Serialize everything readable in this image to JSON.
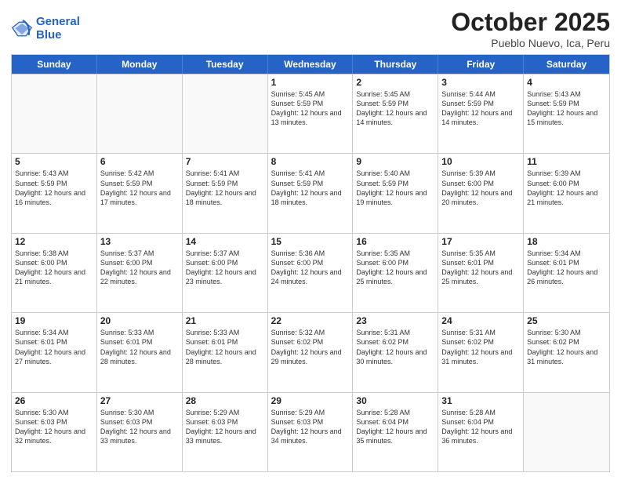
{
  "logo": {
    "line1": "General",
    "line2": "Blue"
  },
  "header": {
    "title": "October 2025",
    "location": "Pueblo Nuevo, Ica, Peru"
  },
  "days_of_week": [
    "Sunday",
    "Monday",
    "Tuesday",
    "Wednesday",
    "Thursday",
    "Friday",
    "Saturday"
  ],
  "weeks": [
    [
      {
        "day": "",
        "empty": true
      },
      {
        "day": "",
        "empty": true
      },
      {
        "day": "",
        "empty": true
      },
      {
        "day": "1",
        "sunrise": "5:45 AM",
        "sunset": "5:59 PM",
        "daylight": "12 hours and 13 minutes."
      },
      {
        "day": "2",
        "sunrise": "5:45 AM",
        "sunset": "5:59 PM",
        "daylight": "12 hours and 14 minutes."
      },
      {
        "day": "3",
        "sunrise": "5:44 AM",
        "sunset": "5:59 PM",
        "daylight": "12 hours and 14 minutes."
      },
      {
        "day": "4",
        "sunrise": "5:43 AM",
        "sunset": "5:59 PM",
        "daylight": "12 hours and 15 minutes."
      }
    ],
    [
      {
        "day": "5",
        "sunrise": "5:43 AM",
        "sunset": "5:59 PM",
        "daylight": "12 hours and 16 minutes."
      },
      {
        "day": "6",
        "sunrise": "5:42 AM",
        "sunset": "5:59 PM",
        "daylight": "12 hours and 17 minutes."
      },
      {
        "day": "7",
        "sunrise": "5:41 AM",
        "sunset": "5:59 PM",
        "daylight": "12 hours and 18 minutes."
      },
      {
        "day": "8",
        "sunrise": "5:41 AM",
        "sunset": "5:59 PM",
        "daylight": "12 hours and 18 minutes."
      },
      {
        "day": "9",
        "sunrise": "5:40 AM",
        "sunset": "5:59 PM",
        "daylight": "12 hours and 19 minutes."
      },
      {
        "day": "10",
        "sunrise": "5:39 AM",
        "sunset": "6:00 PM",
        "daylight": "12 hours and 20 minutes."
      },
      {
        "day": "11",
        "sunrise": "5:39 AM",
        "sunset": "6:00 PM",
        "daylight": "12 hours and 21 minutes."
      }
    ],
    [
      {
        "day": "12",
        "sunrise": "5:38 AM",
        "sunset": "6:00 PM",
        "daylight": "12 hours and 21 minutes."
      },
      {
        "day": "13",
        "sunrise": "5:37 AM",
        "sunset": "6:00 PM",
        "daylight": "12 hours and 22 minutes."
      },
      {
        "day": "14",
        "sunrise": "5:37 AM",
        "sunset": "6:00 PM",
        "daylight": "12 hours and 23 minutes."
      },
      {
        "day": "15",
        "sunrise": "5:36 AM",
        "sunset": "6:00 PM",
        "daylight": "12 hours and 24 minutes."
      },
      {
        "day": "16",
        "sunrise": "5:35 AM",
        "sunset": "6:00 PM",
        "daylight": "12 hours and 25 minutes."
      },
      {
        "day": "17",
        "sunrise": "5:35 AM",
        "sunset": "6:01 PM",
        "daylight": "12 hours and 25 minutes."
      },
      {
        "day": "18",
        "sunrise": "5:34 AM",
        "sunset": "6:01 PM",
        "daylight": "12 hours and 26 minutes."
      }
    ],
    [
      {
        "day": "19",
        "sunrise": "5:34 AM",
        "sunset": "6:01 PM",
        "daylight": "12 hours and 27 minutes."
      },
      {
        "day": "20",
        "sunrise": "5:33 AM",
        "sunset": "6:01 PM",
        "daylight": "12 hours and 28 minutes."
      },
      {
        "day": "21",
        "sunrise": "5:33 AM",
        "sunset": "6:01 PM",
        "daylight": "12 hours and 28 minutes."
      },
      {
        "day": "22",
        "sunrise": "5:32 AM",
        "sunset": "6:02 PM",
        "daylight": "12 hours and 29 minutes."
      },
      {
        "day": "23",
        "sunrise": "5:31 AM",
        "sunset": "6:02 PM",
        "daylight": "12 hours and 30 minutes."
      },
      {
        "day": "24",
        "sunrise": "5:31 AM",
        "sunset": "6:02 PM",
        "daylight": "12 hours and 31 minutes."
      },
      {
        "day": "25",
        "sunrise": "5:30 AM",
        "sunset": "6:02 PM",
        "daylight": "12 hours and 31 minutes."
      }
    ],
    [
      {
        "day": "26",
        "sunrise": "5:30 AM",
        "sunset": "6:03 PM",
        "daylight": "12 hours and 32 minutes."
      },
      {
        "day": "27",
        "sunrise": "5:30 AM",
        "sunset": "6:03 PM",
        "daylight": "12 hours and 33 minutes."
      },
      {
        "day": "28",
        "sunrise": "5:29 AM",
        "sunset": "6:03 PM",
        "daylight": "12 hours and 33 minutes."
      },
      {
        "day": "29",
        "sunrise": "5:29 AM",
        "sunset": "6:03 PM",
        "daylight": "12 hours and 34 minutes."
      },
      {
        "day": "30",
        "sunrise": "5:28 AM",
        "sunset": "6:04 PM",
        "daylight": "12 hours and 35 minutes."
      },
      {
        "day": "31",
        "sunrise": "5:28 AM",
        "sunset": "6:04 PM",
        "daylight": "12 hours and 36 minutes."
      },
      {
        "day": "",
        "empty": true
      }
    ]
  ]
}
